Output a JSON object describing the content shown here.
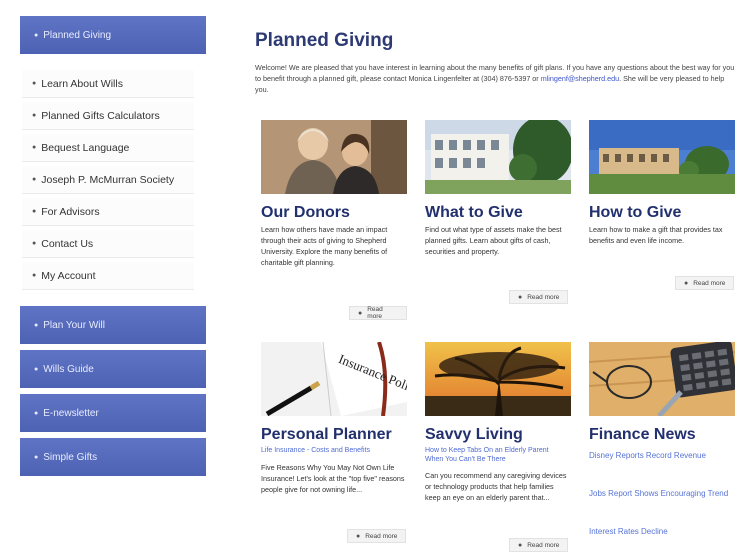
{
  "sidebar": {
    "planned_giving": "Planned Giving",
    "links": [
      "Learn About Wills",
      "Planned Gifts Calculators",
      "Bequest Language",
      "Joseph P. McMurran Society",
      "For Advisors",
      "Contact Us",
      "My Account"
    ],
    "plan_your_will": "Plan Your Will",
    "wills_guide": "Wills Guide",
    "e_newsletter": "E-newsletter",
    "simple_gifts": "Simple Gifts"
  },
  "main": {
    "title": "Planned Giving",
    "intro_text": "Welcome! We are pleased that you have interest in learning about the many benefits of gift plans. If you have any questions about the best way for you to benefit through a planned gift, please contact Monica Lingenfelter at (304) 876-5397 or ",
    "intro_email": "mlingenf@shepherd.edu",
    "intro_end": ". She will be very pleased to help you.",
    "cards": [
      {
        "title": "Our Donors",
        "body": "Learn how others have made an impact through their acts of giving to Shepherd University. Explore the many benefits of charitable gift planning.",
        "read_more": "Read more"
      },
      {
        "title": "What to Give",
        "body": "Find out what type of assets make the best planned gifts. Learn about gifts of cash, securities and property.",
        "read_more": "Read more"
      },
      {
        "title": "How to Give",
        "body": "Learn how to make a gift that provides tax benefits and even life income.",
        "read_more": "Read more"
      },
      {
        "title": "Personal Planner",
        "subtitle": "Life Insurance - Costs and Benefits",
        "body": "Five Reasons Why You May Not Own Life Insurance! Let's look at the \"top five\" reasons people give for not owning life...",
        "read_more": "Read more"
      },
      {
        "title": "Savvy Living",
        "subtitle": "How to Keep Tabs On an Elderly Parent When You Can't Be There",
        "body": "Can you recommend any caregiving devices or technology products that help families keep an eye on an elderly parent that...",
        "read_more": "Read more"
      },
      {
        "title": "Finance News",
        "links": [
          "Disney Reports Record Revenue",
          "Jobs Report Shows Encouraging Trend",
          "Interest Rates Decline"
        ]
      }
    ],
    "insurance_image_text": "Insurance Policy"
  },
  "colors": {
    "sidebar_button": "#5f74c4",
    "title": "#22306e",
    "link": "#5673d6"
  }
}
